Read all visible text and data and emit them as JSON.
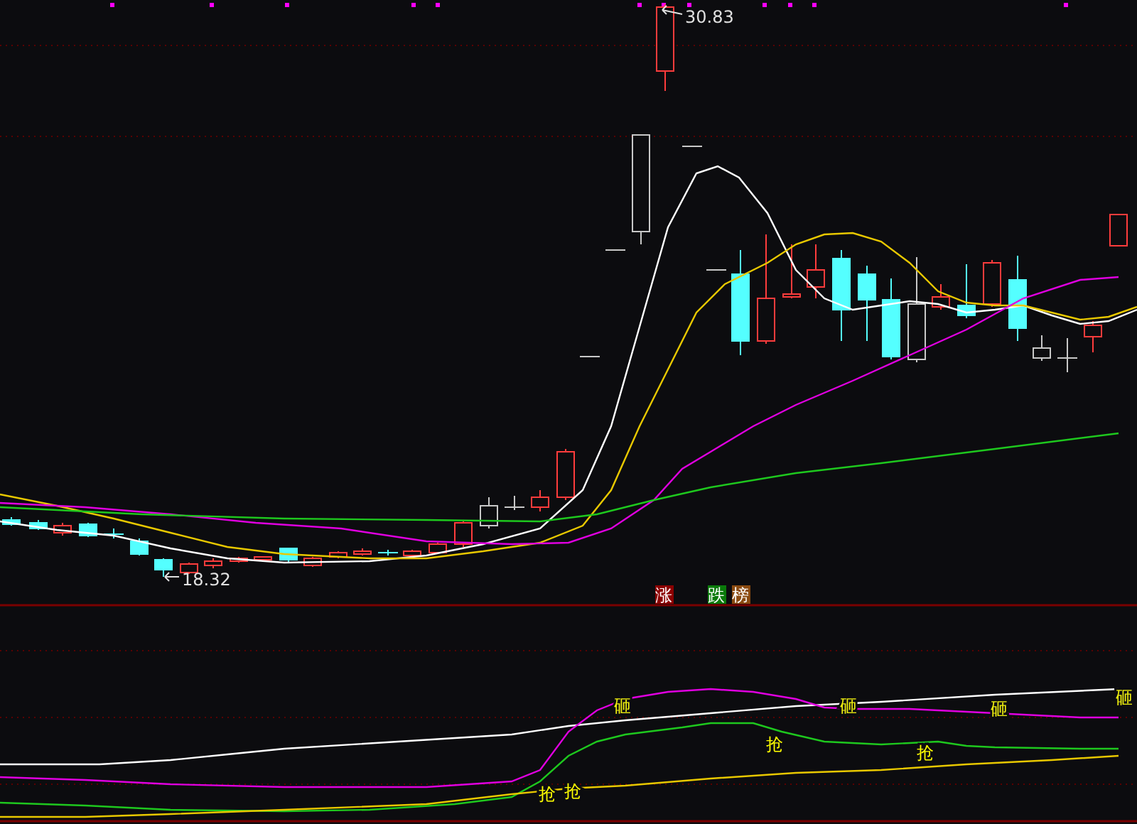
{
  "price_labels": [
    {
      "kind": "high",
      "text": "30.83"
    },
    {
      "kind": "low",
      "text": "18.32"
    }
  ],
  "legend_tags": [
    {
      "text": "涨",
      "color": "#8b0000"
    },
    {
      "text": "跌",
      "color": "#0a7a0a"
    },
    {
      "text": "榜",
      "color": "#8a4a10"
    }
  ],
  "signals": [
    {
      "kind": "buy",
      "text": "抢"
    },
    {
      "kind": "buy",
      "text": "抢"
    },
    {
      "kind": "sell",
      "text": "砸"
    },
    {
      "kind": "buy",
      "text": "抢"
    },
    {
      "kind": "sell",
      "text": "砸"
    },
    {
      "kind": "buy",
      "text": "抢"
    },
    {
      "kind": "sell",
      "text": "砸"
    },
    {
      "kind": "sell",
      "text": "砸"
    }
  ]
}
